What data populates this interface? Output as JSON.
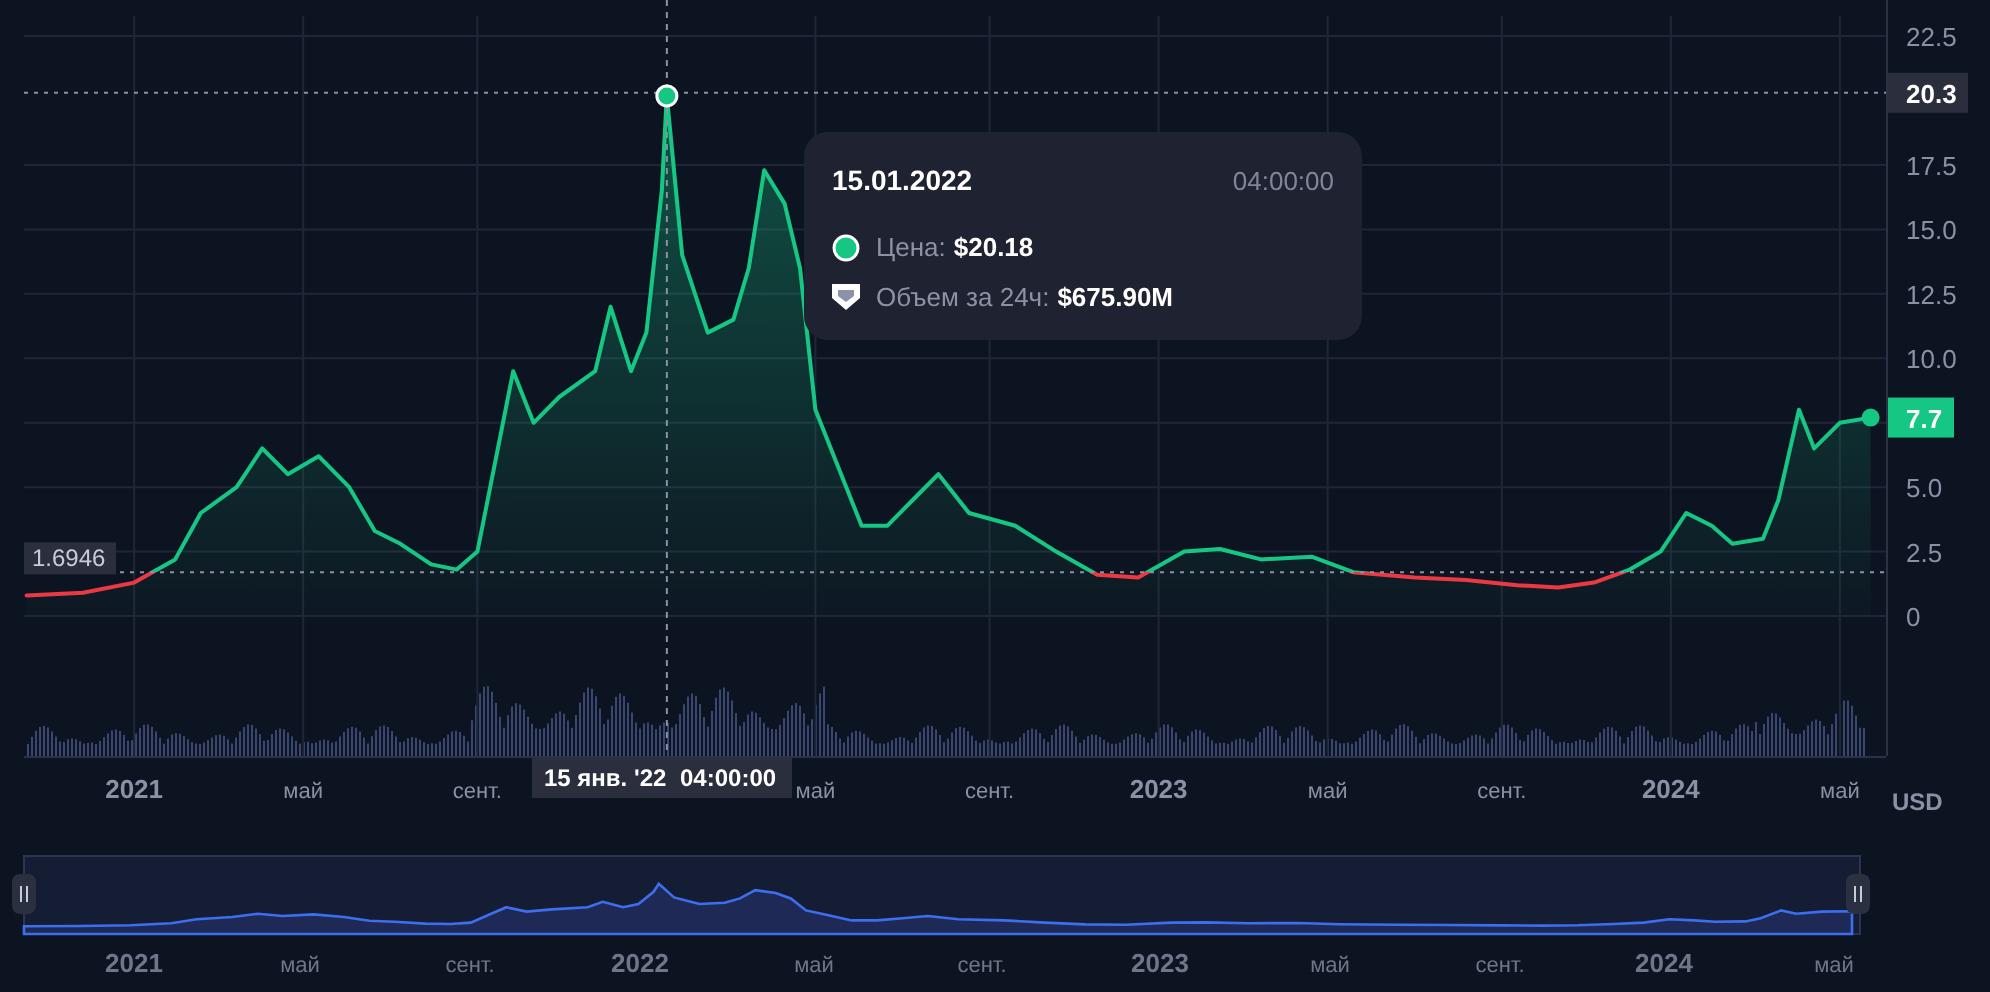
{
  "chart": {
    "chart_data": {
      "type": "area",
      "grid": true,
      "xlim": [
        2020.785,
        2024.42
      ],
      "ylim": [
        -5.43,
        23.9
      ],
      "xticks": [
        {
          "value": 2021,
          "label": "2021"
        },
        {
          "value": 2021.33,
          "label": "май"
        },
        {
          "value": 2021.67,
          "label": "сент."
        },
        {
          "value": 2022.33,
          "label": "май"
        },
        {
          "value": 2022.67,
          "label": "сент."
        },
        {
          "value": 2023,
          "label": "2023"
        },
        {
          "value": 2023.33,
          "label": "май"
        },
        {
          "value": 2023.67,
          "label": "сент."
        },
        {
          "value": 2024,
          "label": "2024"
        },
        {
          "value": 2024.33,
          "label": "май"
        }
      ],
      "yticks": [
        {
          "value": 0,
          "label": "0"
        },
        {
          "value": 2.5,
          "label": "2.5"
        },
        {
          "value": 5,
          "label": "5.0"
        },
        {
          "value": 10,
          "label": "10.0"
        },
        {
          "value": 12.5,
          "label": "12.5"
        },
        {
          "value": 15,
          "label": "15.0"
        },
        {
          "value": 17.5,
          "label": "17.5"
        },
        {
          "value": 22.5,
          "label": "22.5"
        }
      ],
      "x": [
        2020.79,
        2020.9,
        2021.0,
        2021.08,
        2021.13,
        2021.2,
        2021.25,
        2021.3,
        2021.36,
        2021.42,
        2021.47,
        2021.52,
        2021.58,
        2021.63,
        2021.67,
        2021.7,
        2021.74,
        2021.78,
        2021.83,
        2021.9,
        2021.93,
        2021.97,
        2022.0,
        2022.03,
        2022.04,
        2022.07,
        2022.12,
        2022.17,
        2022.2,
        2022.23,
        2022.27,
        2022.3,
        2022.33,
        2022.37,
        2022.42,
        2022.47,
        2022.52,
        2022.57,
        2022.63,
        2022.72,
        2022.8,
        2022.88,
        2022.96,
        2023.05,
        2023.12,
        2023.2,
        2023.3,
        2023.38,
        2023.5,
        2023.6,
        2023.7,
        2023.78,
        2023.85,
        2023.92,
        2023.98,
        2024.03,
        2024.08,
        2024.12,
        2024.18,
        2024.21,
        2024.25,
        2024.28,
        2024.33,
        2024.39
      ],
      "series": [
        {
          "color": "#16c784",
          "values": [
            0.8,
            0.9,
            1.3,
            2.2,
            4.0,
            5.0,
            6.5,
            5.5,
            6.2,
            5.0,
            3.3,
            2.8,
            2.0,
            1.8,
            2.5,
            5.5,
            9.5,
            7.5,
            8.5,
            9.5,
            12.0,
            9.5,
            11.0,
            16.5,
            20.18,
            14.0,
            11.0,
            11.5,
            13.5,
            17.3,
            16.0,
            13.5,
            8.0,
            6.0,
            3.5,
            3.5,
            4.5,
            5.5,
            4.0,
            3.5,
            2.5,
            1.6,
            1.5,
            2.5,
            2.6,
            2.2,
            2.3,
            1.7,
            1.5,
            1.4,
            1.2,
            1.1,
            1.3,
            1.8,
            2.5,
            4.0,
            3.5,
            2.8,
            3.0,
            4.5,
            8.0,
            6.5,
            7.5,
            7.7
          ]
        }
      ]
    },
    "baseline_label": "1.6946",
    "crosshair": {
      "price_label": "20.3",
      "date_label": "15 янв. '22",
      "time_label": "04:00:00"
    },
    "last_price_label": "7.7"
  },
  "currency": "USD",
  "tooltip": {
    "date": "15.01.2022",
    "time": "04:00:00",
    "rows": [
      {
        "kind": "price",
        "label": "Цена:",
        "value": "$20.18"
      },
      {
        "kind": "volume",
        "label": "Объем за 24ч:",
        "value": "$675.90M"
      }
    ]
  },
  "navigator": {
    "labels": [
      "2021",
      "май",
      "сент.",
      "2022",
      "май",
      "сент.",
      "2023",
      "май",
      "сент.",
      "2024",
      "май"
    ]
  }
}
